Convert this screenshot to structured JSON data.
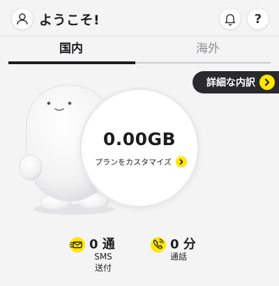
{
  "header": {
    "welcome": "ようこそ!",
    "help_label": "?"
  },
  "tabs": [
    {
      "label": "国内",
      "active": true
    },
    {
      "label": "海外",
      "active": false
    }
  ],
  "detail_button": {
    "label": "詳細な内訳"
  },
  "data_usage": {
    "value": "0.00GB",
    "customize_label": "プランをカスタマイズ"
  },
  "stats": {
    "sms": {
      "value": "0 通",
      "label_line1": "SMS",
      "label_line2": "送付",
      "icon": "sms-icon"
    },
    "call": {
      "value": "0 分",
      "label": "通話",
      "icon": "phone-icon"
    }
  },
  "colors": {
    "accent": "#ffe600",
    "dark": "#2a2a2c",
    "background": "#f4f4f5"
  }
}
